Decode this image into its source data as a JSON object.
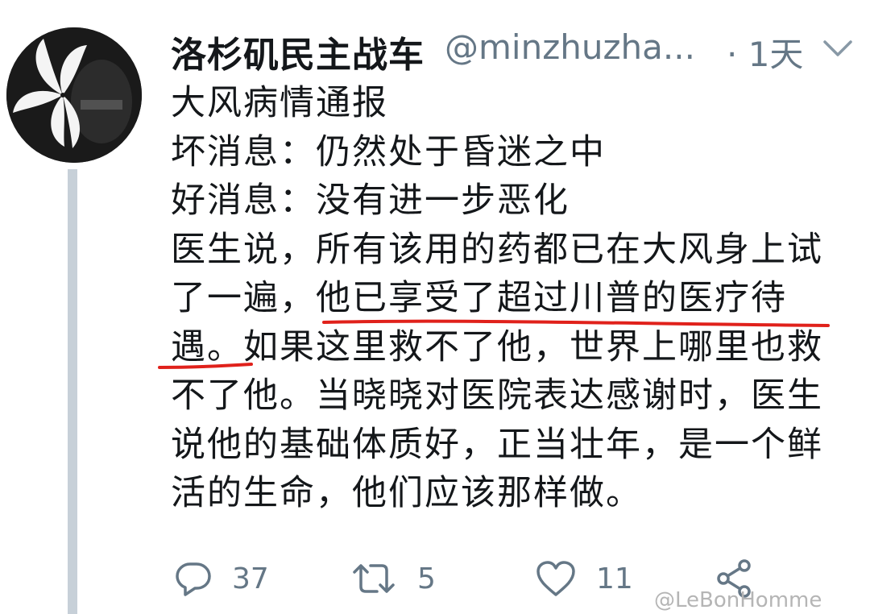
{
  "tweet": {
    "display_name": "洛杉矶民主战车",
    "handle": "@minzhuzha...",
    "timestamp": "· 1天",
    "body_lines": [
      "大风病情通报",
      "坏消息：仍然处于昏迷之中",
      "好消息：没有进一步恶化",
      "医生说，所有该用的药都已在大风身上试",
      "了一遍，他已享受了超过川普的医疗待",
      "遇。如果这里救不了他，世界上哪里也救",
      "不了他。当晓晓对医院表达感谢时，医生",
      "说他的基础体质好，正当壮年，是一个鲜",
      "活的生命，他们应该那样做。"
    ],
    "highlight_color": "#e0211b"
  },
  "actions": {
    "reply_count": "37",
    "retweet_count": "5",
    "like_count": "11"
  },
  "icons": {
    "reply": "reply-icon",
    "retweet": "retweet-icon",
    "like": "heart-icon",
    "share": "share-icon",
    "caret": "chevron-down-icon"
  },
  "watermark": {
    "text": "@LeBonHomme"
  },
  "colors": {
    "text": "#14171a",
    "secondary": "#657786",
    "thread_line": "#c7d0d8"
  }
}
